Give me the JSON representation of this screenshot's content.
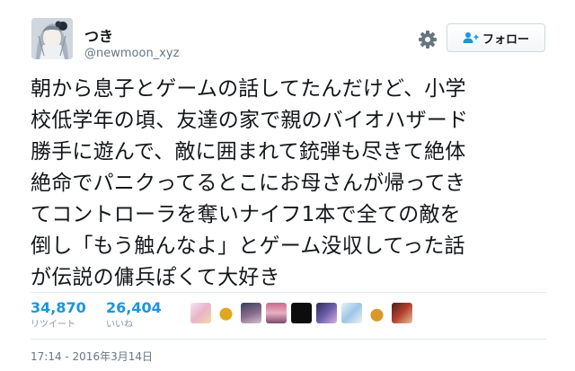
{
  "author": {
    "display_name": "つき",
    "screen_name": "@newmoon_xyz"
  },
  "follow_button": {
    "label": "フォロー",
    "icon": "person-plus-icon"
  },
  "settings_icon": "gear-icon",
  "tweet": {
    "lines": [
      "朝から息子とゲームの話してたんだけど、小学",
      "校低学年の頃、友達の家で親のバイオハザード",
      "勝手に遊んで、敵に囲まれて銃弾も尽きて絶体",
      "絶命でパニクってるとこにお母さんが帰ってき",
      "てコントローラを奪いナイフ1本で全ての敵を",
      "倒し「もう触んなよ」とゲーム没収してった話",
      "が伝説の傭兵ぽくて大好き"
    ]
  },
  "stats": {
    "retweets": {
      "count": "34,870",
      "label": "リツイート"
    },
    "likes": {
      "count": "26,404",
      "label": "いいね"
    }
  },
  "timestamp": "17:14 - 2016年3月14日",
  "colors": {
    "accent": "#1b95e0",
    "text": "#14171a",
    "secondary": "#657786",
    "muted": "#8899a6",
    "divider": "#e1e8ed"
  }
}
